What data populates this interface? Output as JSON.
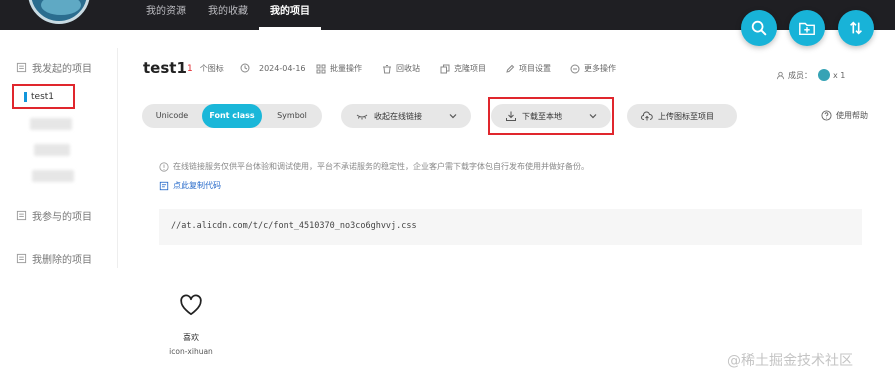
{
  "nav": {
    "items": [
      {
        "label": "我的资源",
        "active": false
      },
      {
        "label": "我的收藏",
        "active": false
      },
      {
        "label": "我的项目",
        "active": true
      }
    ]
  },
  "fabs": [
    "search-icon",
    "folder-add-icon",
    "sort-icon"
  ],
  "sidebar": {
    "created_label": "我发起的项目",
    "selected_project": "test1",
    "joined_label": "我参与的项目",
    "deleted_label": "我删除的项目"
  },
  "project": {
    "name": "test1",
    "icon_count": "1",
    "icon_count_unit": "个图标",
    "date": "2024-04-16",
    "batch": "批量操作",
    "trash": "回收站",
    "clone": "克隆项目",
    "settings": "项目设置",
    "more": "更多操作",
    "members_label": "成员：",
    "members_count": "x 1"
  },
  "toolbar": {
    "tabs": [
      {
        "label": "Unicode",
        "active": false
      },
      {
        "label": "Font class",
        "active": true
      },
      {
        "label": "Symbol",
        "active": false
      }
    ],
    "collapse_label": "收起在线链接",
    "download_label": "下载至本地",
    "upload_label": "上传图标至项目",
    "help_label": "使用帮助"
  },
  "info": {
    "notice": "在线链接服务仅供平台体验和调试使用，平台不承诺服务的稳定性，企业客户需下载字体包自行发布使用并做好备份。",
    "copy_code": "点此复制代码",
    "css_url": "//at.alicdn.com/t/c/font_4510370_no3co6ghvvj.css"
  },
  "icon": {
    "name": "喜欢",
    "code": "icon-xihuan"
  },
  "watermark": "@稀土掘金技术社区",
  "colors": {
    "accent": "#1ab7d9",
    "highlight": "#e0262d",
    "topbar": "#1f1f23"
  }
}
